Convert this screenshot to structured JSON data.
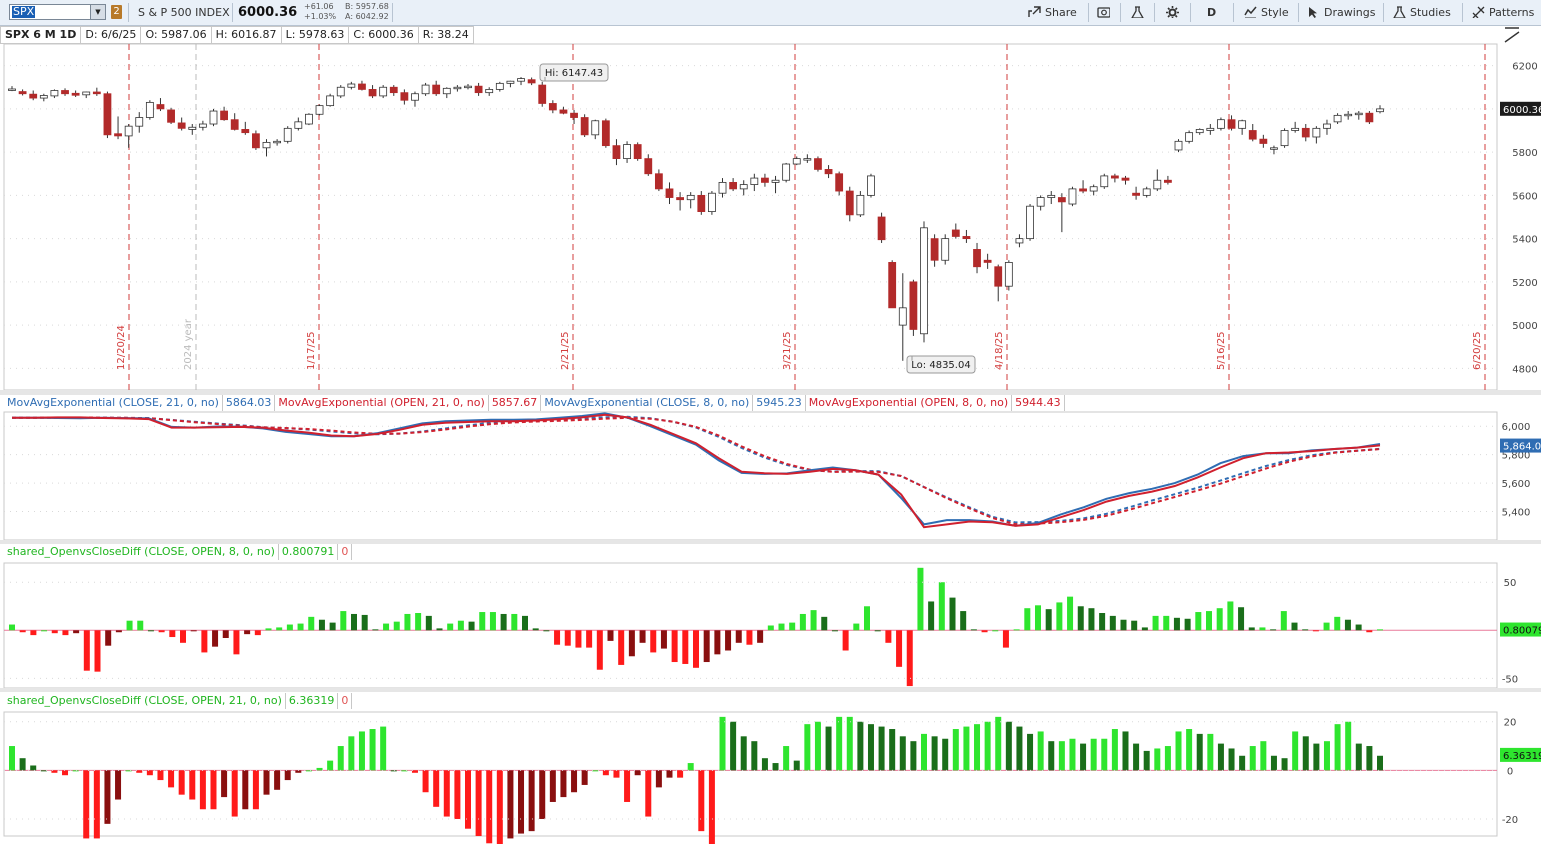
{
  "toolbar": {
    "symbol": "SPX",
    "link_number": "2",
    "instrument_name": "S & P 500 INDEX",
    "last_price": "6000.36",
    "net_change": "+61.06",
    "pct_change": "+1.03%",
    "bid": "B: 5957.68",
    "ask": "A: 6042.92",
    "share_label": "Share",
    "aggregation_label": "D",
    "style_label": "Style",
    "drawings_label": "Drawings",
    "studies_label": "Studies",
    "patterns_label": "Patterns"
  },
  "info_bar": {
    "chart_title": "SPX 6 M 1D",
    "date": "D: 6/6/25",
    "open": "O: 5987.06",
    "high": "H: 6016.87",
    "low": "L: 5978.63",
    "close": "C: 6000.36",
    "range": "R: 38.24"
  },
  "colors": {
    "bull_candle": "#ffffff",
    "bear_candle": "#b22a2a",
    "close_ema": "#2f6db3",
    "open_ema": "#d0202e",
    "hist_pos_bright": "#2ee52e",
    "hist_pos_dark": "#1a6e1a",
    "hist_neg_bright": "#ff1a1a",
    "hist_neg_dark": "#8a0f0f",
    "period_line": "#d23c3c",
    "price_bubble": "#1b1b1b"
  },
  "price_panel": {
    "hi_label": "Hi: 6147.43",
    "lo_label": "Lo: 4835.04",
    "price_bubble": "6000.36",
    "y_ticks": [
      "6200",
      "6000",
      "5800",
      "5600",
      "5400",
      "5200",
      "5000",
      "4800"
    ],
    "date_markers": [
      "12/20/24",
      "2024 year",
      "1/17/25",
      "2/21/25",
      "3/21/25",
      "4/18/25",
      "5/16/25",
      "6/20/25"
    ]
  },
  "ema_panel": {
    "legends": [
      {
        "label": "MovAvgExponential (CLOSE, 21, 0, no)",
        "value": "5864.03"
      },
      {
        "label": "MovAvgExponential (OPEN, 21, 0, no)",
        "value": "5857.67"
      },
      {
        "label": "MovAvgExponential (CLOSE, 8, 0, no)",
        "value": "5945.23"
      },
      {
        "label": "MovAvgExponential (OPEN, 8, 0, no)",
        "value": "5944.43"
      }
    ],
    "y_ticks": [
      "6,000",
      "5,800",
      "5,600",
      "5,400"
    ],
    "price_bubble": "5,864.0"
  },
  "hist8_panel": {
    "label": "shared_OpenvsCloseDiff (CLOSE, OPEN, 8, 0, no)",
    "value": "0.800791",
    "zero": "0",
    "y_ticks": [
      "50",
      "-50"
    ],
    "price_bubble": "0.80079"
  },
  "hist21_panel": {
    "label": "shared_OpenvsCloseDiff (CLOSE, OPEN, 21, 0, no)",
    "value": "6.36319",
    "zero": "0",
    "y_ticks": [
      "20",
      "0",
      "-20"
    ],
    "price_bubble": "6.36319"
  },
  "chart_data": {
    "type": "candlestick",
    "ylim": [
      4700,
      6300
    ],
    "ohlc": [
      [
        6090,
        6105,
        6082,
        6092
      ],
      [
        6080,
        6090,
        6062,
        6070
      ],
      [
        6068,
        6085,
        6040,
        6050
      ],
      [
        6050,
        6070,
        6035,
        6062
      ],
      [
        6060,
        6090,
        6050,
        6085
      ],
      [
        6085,
        6095,
        6060,
        6070
      ],
      [
        6072,
        6085,
        6055,
        6063
      ],
      [
        6065,
        6080,
        6050,
        6078
      ],
      [
        6078,
        6098,
        6060,
        6070
      ],
      [
        6070,
        6080,
        5865,
        5880
      ],
      [
        5885,
        5965,
        5860,
        5875
      ],
      [
        5875,
        5930,
        5820,
        5920
      ],
      [
        5920,
        5985,
        5890,
        5960
      ],
      [
        5960,
        6040,
        5950,
        6030
      ],
      [
        6020,
        6050,
        5990,
        6000
      ],
      [
        5995,
        6005,
        5930,
        5938
      ],
      [
        5935,
        5960,
        5900,
        5910
      ],
      [
        5905,
        5930,
        5880,
        5915
      ],
      [
        5915,
        5945,
        5900,
        5930
      ],
      [
        5930,
        6000,
        5920,
        5990
      ],
      [
        5990,
        6010,
        5945,
        5950
      ],
      [
        5950,
        5980,
        5900,
        5905
      ],
      [
        5905,
        5940,
        5880,
        5890
      ],
      [
        5885,
        5900,
        5810,
        5820
      ],
      [
        5820,
        5860,
        5780,
        5845
      ],
      [
        5845,
        5860,
        5830,
        5850
      ],
      [
        5850,
        5920,
        5840,
        5910
      ],
      [
        5910,
        5960,
        5900,
        5940
      ],
      [
        5930,
        5980,
        5925,
        5975
      ],
      [
        5975,
        6020,
        5970,
        6015
      ],
      [
        6015,
        6070,
        6010,
        6060
      ],
      [
        6060,
        6110,
        6050,
        6100
      ],
      [
        6100,
        6125,
        6090,
        6115
      ],
      [
        6115,
        6130,
        6085,
        6090
      ],
      [
        6090,
        6110,
        6050,
        6060
      ],
      [
        6060,
        6110,
        6050,
        6100
      ],
      [
        6100,
        6110,
        6060,
        6075
      ],
      [
        6075,
        6090,
        6020,
        6040
      ],
      [
        6040,
        6080,
        6010,
        6070
      ],
      [
        6070,
        6120,
        6060,
        6110
      ],
      [
        6110,
        6130,
        6060,
        6070
      ],
      [
        6070,
        6100,
        6050,
        6095
      ],
      [
        6095,
        6110,
        6080,
        6100
      ],
      [
        6100,
        6115,
        6090,
        6105
      ],
      [
        6105,
        6120,
        6060,
        6075
      ],
      [
        6075,
        6100,
        6060,
        6090
      ],
      [
        6090,
        6125,
        6080,
        6118
      ],
      [
        6118,
        6130,
        6100,
        6128
      ],
      [
        6128,
        6147,
        6110,
        6140
      ],
      [
        6135,
        6145,
        6110,
        6120
      ],
      [
        6110,
        6125,
        6010,
        6025
      ],
      [
        6025,
        6040,
        5980,
        5995
      ],
      [
        5995,
        6010,
        5975,
        5980
      ],
      [
        5980,
        5995,
        5930,
        5960
      ],
      [
        5960,
        5975,
        5870,
        5880
      ],
      [
        5880,
        5950,
        5860,
        5945
      ],
      [
        5945,
        5955,
        5820,
        5830
      ],
      [
        5830,
        5860,
        5740,
        5770
      ],
      [
        5770,
        5850,
        5750,
        5835
      ],
      [
        5835,
        5845,
        5760,
        5770
      ],
      [
        5770,
        5790,
        5690,
        5700
      ],
      [
        5700,
        5720,
        5620,
        5630
      ],
      [
        5630,
        5660,
        5560,
        5590
      ],
      [
        5590,
        5615,
        5530,
        5580
      ],
      [
        5580,
        5615,
        5540,
        5600
      ],
      [
        5600,
        5620,
        5510,
        5525
      ],
      [
        5525,
        5620,
        5510,
        5610
      ],
      [
        5610,
        5680,
        5590,
        5660
      ],
      [
        5660,
        5680,
        5620,
        5630
      ],
      [
        5630,
        5670,
        5600,
        5650
      ],
      [
        5650,
        5700,
        5620,
        5680
      ],
      [
        5680,
        5700,
        5640,
        5660
      ],
      [
        5660,
        5690,
        5610,
        5670
      ],
      [
        5670,
        5750,
        5660,
        5745
      ],
      [
        5745,
        5780,
        5740,
        5770
      ],
      [
        5770,
        5790,
        5750,
        5770
      ],
      [
        5770,
        5780,
        5710,
        5720
      ],
      [
        5720,
        5740,
        5680,
        5700
      ],
      [
        5700,
        5710,
        5600,
        5620
      ],
      [
        5620,
        5640,
        5480,
        5510
      ],
      [
        5510,
        5620,
        5500,
        5600
      ],
      [
        5600,
        5700,
        5590,
        5690
      ],
      [
        5500,
        5520,
        5380,
        5395
      ],
      [
        5290,
        5300,
        5080,
        5080
      ],
      [
        5000,
        5240,
        4835,
        5080
      ],
      [
        5200,
        5210,
        4950,
        4980
      ],
      [
        4960,
        5480,
        4920,
        5450
      ],
      [
        5400,
        5420,
        5270,
        5300
      ],
      [
        5300,
        5420,
        5280,
        5400
      ],
      [
        5440,
        5470,
        5400,
        5410
      ],
      [
        5410,
        5440,
        5380,
        5400
      ],
      [
        5350,
        5380,
        5240,
        5270
      ],
      [
        5300,
        5330,
        5260,
        5290
      ],
      [
        5270,
        5280,
        5110,
        5180
      ],
      [
        5180,
        5300,
        5160,
        5290
      ],
      [
        5380,
        5420,
        5360,
        5400
      ],
      [
        5400,
        5560,
        5390,
        5550
      ],
      [
        5550,
        5600,
        5530,
        5590
      ],
      [
        5590,
        5620,
        5560,
        5600
      ],
      [
        5590,
        5610,
        5430,
        5570
      ],
      [
        5560,
        5640,
        5550,
        5630
      ],
      [
        5630,
        5670,
        5610,
        5620
      ],
      [
        5620,
        5650,
        5600,
        5640
      ],
      [
        5640,
        5700,
        5630,
        5690
      ],
      [
        5690,
        5700,
        5660,
        5680
      ],
      [
        5680,
        5690,
        5650,
        5670
      ],
      [
        5610,
        5640,
        5580,
        5600
      ],
      [
        5600,
        5640,
        5590,
        5630
      ],
      [
        5630,
        5720,
        5620,
        5670
      ],
      [
        5670,
        5690,
        5650,
        5660
      ],
      [
        5810,
        5860,
        5800,
        5850
      ],
      [
        5850,
        5900,
        5840,
        5890
      ],
      [
        5890,
        5910,
        5880,
        5905
      ],
      [
        5900,
        5930,
        5880,
        5910
      ],
      [
        5910,
        5960,
        5900,
        5950
      ],
      [
        5950,
        5970,
        5900,
        5910
      ],
      [
        5910,
        5950,
        5880,
        5945
      ],
      [
        5900,
        5930,
        5850,
        5860
      ],
      [
        5860,
        5880,
        5820,
        5840
      ],
      [
        5820,
        5830,
        5790,
        5820
      ],
      [
        5830,
        5910,
        5820,
        5900
      ],
      [
        5900,
        5940,
        5890,
        5910
      ],
      [
        5910,
        5930,
        5850,
        5870
      ],
      [
        5870,
        5920,
        5840,
        5910
      ],
      [
        5910,
        5950,
        5880,
        5930
      ],
      [
        5940,
        5980,
        5930,
        5970
      ],
      [
        5970,
        5990,
        5950,
        5975
      ],
      [
        5975,
        5990,
        5950,
        5980
      ],
      [
        5980,
        5990,
        5930,
        5940
      ],
      [
        5987,
        6017,
        5979,
        6000
      ]
    ],
    "ema_close_21": [
      6060,
      6060,
      6058,
      6056,
      6060,
      6057,
      6055,
      5995,
      5990,
      5998,
      5997,
      5985,
      5960,
      5945,
      5930,
      5930,
      5950,
      5985,
      6020,
      6035,
      6040,
      6045,
      6045,
      6048,
      6060,
      6072,
      6090,
      6060,
      6000,
      5935,
      5870,
      5760,
      5672,
      5665,
      5668,
      5690,
      5710,
      5690,
      5660,
      5495,
      5310,
      5340,
      5340,
      5330,
      5300,
      5320,
      5380,
      5430,
      5490,
      5530,
      5560,
      5600,
      5660,
      5740,
      5790,
      5810,
      5810,
      5830,
      5840,
      5850,
      5875
    ],
    "ema_open_21": [
      6060,
      6060,
      6062,
      6062,
      6058,
      6055,
      6050,
      5990,
      5990,
      5993,
      5995,
      5990,
      5970,
      5955,
      5935,
      5930,
      5945,
      5975,
      6010,
      6025,
      6030,
      6035,
      6035,
      6040,
      6050,
      6062,
      6080,
      6062,
      6010,
      5945,
      5880,
      5775,
      5680,
      5670,
      5665,
      5680,
      5700,
      5690,
      5660,
      5520,
      5290,
      5310,
      5330,
      5325,
      5300,
      5310,
      5360,
      5410,
      5470,
      5510,
      5540,
      5580,
      5640,
      5710,
      5775,
      5810,
      5815,
      5825,
      5840,
      5850,
      5865
    ],
    "ema_close_8": [
      6060,
      6063,
      6064,
      6065,
      6063,
      6060,
      6057,
      6015,
      5985,
      5985,
      5990,
      5990,
      5970,
      5970,
      5940,
      5935,
      5945,
      5975,
      6000,
      6015,
      6025,
      6030,
      6030,
      6035,
      6045,
      6050,
      6060,
      6050,
      6010,
      5975,
      5920,
      5840,
      5780,
      5760,
      5750,
      5745,
      5740,
      5710,
      5600,
      5490,
      5460,
      5430,
      5400,
      5390,
      5390,
      5385,
      5390,
      5420,
      5460,
      5490,
      5510,
      5550,
      5570,
      5610,
      5650,
      5700,
      5720,
      5750,
      5770,
      5790,
      5830
    ],
    "ema_open_8": [
      6060,
      6063,
      6064,
      6065,
      6063,
      6060,
      6057,
      6015,
      5985,
      5985,
      5990,
      5990,
      5970,
      5970,
      5940,
      5935,
      5945,
      5975,
      6000,
      6015,
      6025,
      6030,
      6030,
      6035,
      6045,
      6050,
      6060,
      6050,
      6010,
      5975,
      5920,
      5840,
      5780,
      5760,
      5750,
      5745,
      5740,
      5710,
      5600,
      5490,
      5460,
      5430,
      5400,
      5390,
      5390,
      5385,
      5390,
      5420,
      5460,
      5490,
      5510,
      5550,
      5570,
      5610,
      5650,
      5700,
      5720,
      5750,
      5770,
      5790,
      5830
    ],
    "hist_8": [
      6,
      -2,
      -5,
      0,
      -3,
      -5,
      -3,
      -42,
      -43,
      -16,
      -2,
      10,
      10,
      0,
      -2,
      -7,
      -13,
      -1,
      -23,
      -17,
      -8,
      -25,
      -4,
      -5,
      2,
      3,
      6,
      7,
      14,
      11,
      8,
      20,
      17,
      16,
      1,
      7,
      9,
      17,
      18,
      15,
      2,
      7,
      10,
      9,
      19,
      19,
      17,
      17,
      15,
      2,
      0,
      -15,
      -16,
      -18,
      -18,
      -41,
      -11,
      -36,
      -27,
      -13,
      -23,
      -19,
      -33,
      -35,
      -39,
      -33,
      -25,
      -21,
      -13,
      -15,
      -13,
      5,
      7,
      8,
      17,
      21,
      14,
      0,
      -21,
      7,
      25,
      0,
      -13,
      -38,
      -58,
      65,
      30,
      50,
      34,
      20,
      1,
      -2,
      0,
      -18,
      1,
      23,
      26,
      22,
      29,
      35,
      25,
      23,
      18,
      15,
      11,
      10,
      3,
      15,
      15,
      13,
      12,
      19,
      20,
      23,
      30,
      24,
      3,
      3,
      1,
      20,
      8,
      1,
      -1,
      8,
      14,
      11,
      6,
      -2,
      1
    ],
    "hist_21": [
      10,
      5,
      2,
      0,
      -1,
      -2,
      0,
      -28,
      -28,
      -22,
      -12,
      0,
      -1,
      -2,
      -4,
      -7,
      -10,
      -12,
      -16,
      -16,
      -11,
      -19,
      -16,
      -16,
      -10,
      -8,
      -4,
      -1,
      0,
      1,
      4,
      10,
      14,
      16,
      17,
      18,
      0,
      0,
      -1,
      -9,
      -15,
      -19,
      -20,
      -24,
      -27,
      -30,
      -31,
      -28,
      -26,
      -25,
      -20,
      -13,
      -11,
      -9,
      -6,
      0,
      -2,
      -3,
      -13,
      -2,
      -19,
      -7,
      -3,
      -3,
      3,
      -25,
      -32,
      22,
      20,
      14,
      12,
      5,
      3,
      10,
      4,
      19,
      20,
      18,
      22,
      22,
      20,
      19,
      18,
      17,
      14,
      12,
      15,
      14,
      13,
      17,
      18,
      19,
      20,
      22,
      20,
      18,
      15,
      16,
      12,
      12,
      13,
      11,
      13,
      13,
      17,
      16,
      11,
      8,
      9,
      10,
      16,
      17,
      15,
      15,
      11,
      9,
      6,
      10,
      12,
      6,
      5,
      16,
      14,
      11,
      12,
      19,
      20,
      11,
      10,
      6
    ],
    "period_dates": [
      "12/20/24",
      "1/17/25",
      "2/21/25",
      "3/21/25",
      "4/18/25",
      "5/16/25",
      "6/20/25"
    ]
  }
}
